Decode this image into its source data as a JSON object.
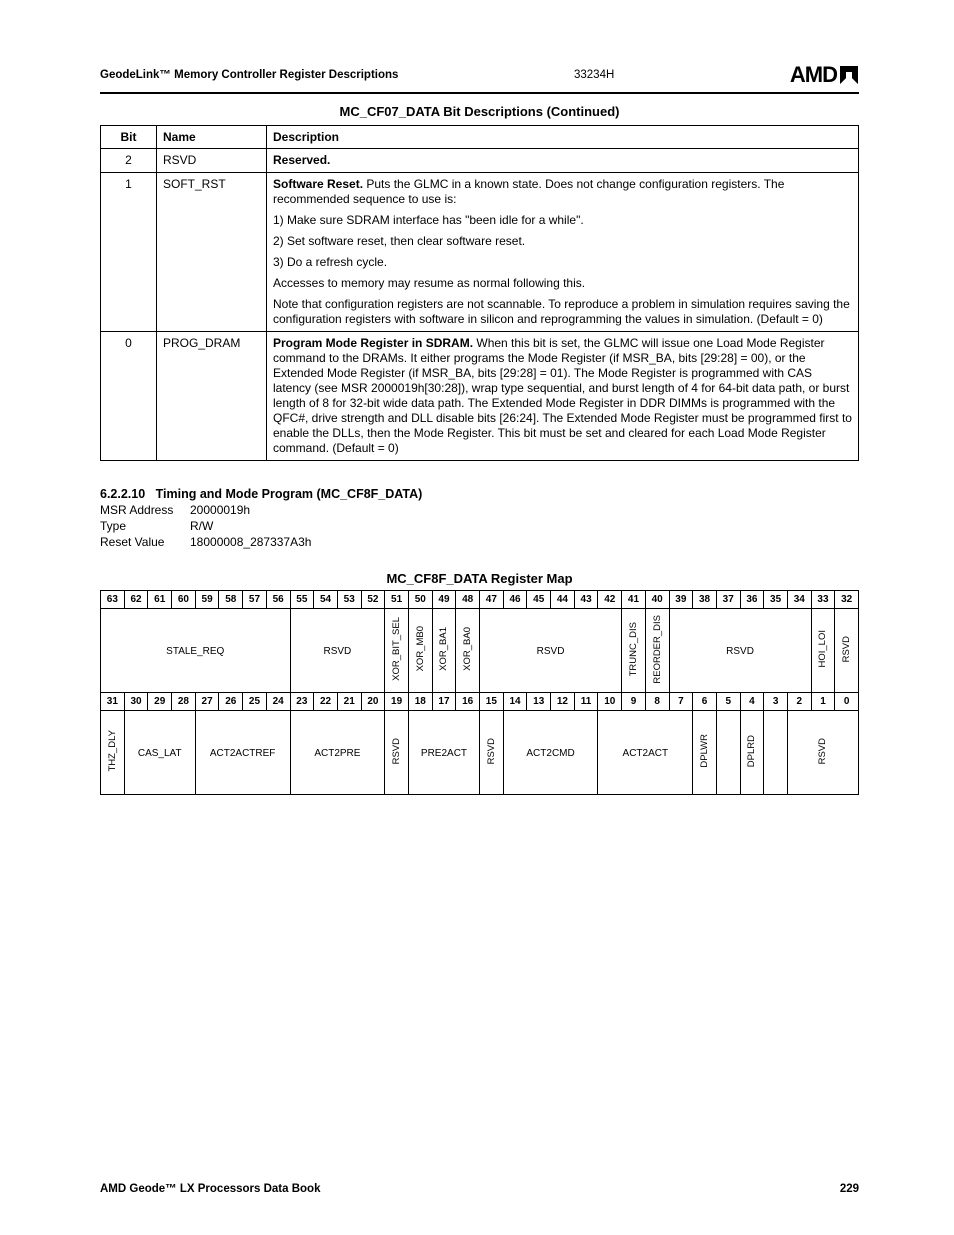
{
  "header": {
    "left": "GeodeLink™ Memory Controller Register Descriptions",
    "docnum": "33234H",
    "logo_text": "AMD"
  },
  "table1": {
    "title": "MC_CF07_DATA Bit Descriptions (Continued)",
    "headers": [
      "Bit",
      "Name",
      "Description"
    ],
    "rows": [
      {
        "bit": "2",
        "name": "RSVD",
        "desc": [
          "<b>Reserved.</b>"
        ]
      },
      {
        "bit": "1",
        "name": "SOFT_RST",
        "desc": [
          "<b>Software Reset.</b> Puts the GLMC in a known state. Does not change configuration registers. The recommended sequence to use is:",
          "1) Make sure SDRAM interface has \"been idle for a while\".",
          "2) Set software reset, then clear software reset.",
          "3) Do a refresh cycle.",
          "Accesses to memory may resume as normal following this.",
          "Note that configuration registers are not scannable. To reproduce a problem in simulation requires saving the configuration registers with software in silicon and reprogramming the values in simulation. (Default = 0)"
        ]
      },
      {
        "bit": "0",
        "name": "PROG_DRAM",
        "desc": [
          "<b>Program Mode Register in SDRAM.</b> When this bit is set, the GLMC will issue one Load Mode Register command to the DRAMs. It either programs the Mode Register (if MSR_BA, bits [29:28] = 00), or the Extended Mode Register (if MSR_BA, bits [29:28] = 01). The Mode Register is programmed with CAS latency (see MSR 2000019h[30:28]), wrap type sequential, and burst length of 4 for 64-bit data path, or burst length of 8 for 32-bit wide data path. The Extended Mode Register in DDR DIMMs is programmed with the QFC#, drive strength and DLL disable bits [26:24]. The Extended Mode Register must be programmed first to enable the DLLs, then the Mode Register. This bit must be set and cleared for each Load Mode Register command. (Default = 0)"
        ]
      }
    ]
  },
  "section": {
    "number": "6.2.2.10",
    "title": "Timing and Mode Program (MC_CF8F_DATA)",
    "msr_label": "MSR Address",
    "msr_value": "20000019h",
    "type_label": "Type",
    "type_value": "R/W",
    "reset_label": "Reset Value",
    "reset_value": "18000008_287337A3h"
  },
  "regmap": {
    "title": "MC_CF8F_DATA Register Map",
    "bits_high": [
      "63",
      "62",
      "61",
      "60",
      "59",
      "58",
      "57",
      "56",
      "55",
      "54",
      "53",
      "52",
      "51",
      "50",
      "49",
      "48",
      "47",
      "46",
      "45",
      "44",
      "43",
      "42",
      "41",
      "40",
      "39",
      "38",
      "37",
      "36",
      "35",
      "34",
      "33",
      "32"
    ],
    "fields_high": [
      {
        "span": 8,
        "label": "STALE_REQ",
        "vertical": false
      },
      {
        "span": 4,
        "label": "RSVD",
        "vertical": false
      },
      {
        "span": 1,
        "label": "XOR_BIT_SEL",
        "vertical": true
      },
      {
        "span": 1,
        "label": "XOR_MB0",
        "vertical": true
      },
      {
        "span": 1,
        "label": "XOR_BA1",
        "vertical": true
      },
      {
        "span": 1,
        "label": "XOR_BA0",
        "vertical": true
      },
      {
        "span": 6,
        "label": "RSVD",
        "vertical": false
      },
      {
        "span": 1,
        "label": "TRUNC_DIS",
        "vertical": true
      },
      {
        "span": 1,
        "label": "REORDER_DIS",
        "vertical": true
      },
      {
        "span": 6,
        "label": "RSVD",
        "vertical": false
      },
      {
        "span": 1,
        "label": "HOI_LOI",
        "vertical": true
      },
      {
        "span": 1,
        "label": "RSVD",
        "vertical": true
      }
    ],
    "bits_low": [
      "31",
      "30",
      "29",
      "28",
      "27",
      "26",
      "25",
      "24",
      "23",
      "22",
      "21",
      "20",
      "19",
      "18",
      "17",
      "16",
      "15",
      "14",
      "13",
      "12",
      "11",
      "10",
      "9",
      "8",
      "7",
      "6",
      "5",
      "4",
      "3",
      "2",
      "1",
      "0"
    ],
    "fields_low": [
      {
        "span": 1,
        "label": "THZ_DLY",
        "vertical": true
      },
      {
        "span": 3,
        "label": "CAS_LAT",
        "vertical": false
      },
      {
        "span": 4,
        "label": "ACT2ACTREF",
        "vertical": false
      },
      {
        "span": 4,
        "label": "ACT2PRE",
        "vertical": false
      },
      {
        "span": 1,
        "label": "RSVD",
        "vertical": true
      },
      {
        "span": 3,
        "label": "PRE2ACT",
        "vertical": false
      },
      {
        "span": 1,
        "label": "RSVD",
        "vertical": true
      },
      {
        "span": 4,
        "label": "ACT2CMD",
        "vertical": false
      },
      {
        "span": 4,
        "label": "ACT2ACT",
        "vertical": false
      },
      {
        "span": 1,
        "label": "DPLWR",
        "vertical": true
      },
      {
        "span": 1,
        "label": "",
        "vertical": false
      },
      {
        "span": 1,
        "label": "DPLRD",
        "vertical": true
      },
      {
        "span": 1,
        "label": "",
        "vertical": false
      },
      {
        "span": 3,
        "label": "RSVD",
        "vertical": true
      }
    ]
  },
  "footer": {
    "left": "AMD Geode™ LX Processors Data Book",
    "right": "229"
  }
}
